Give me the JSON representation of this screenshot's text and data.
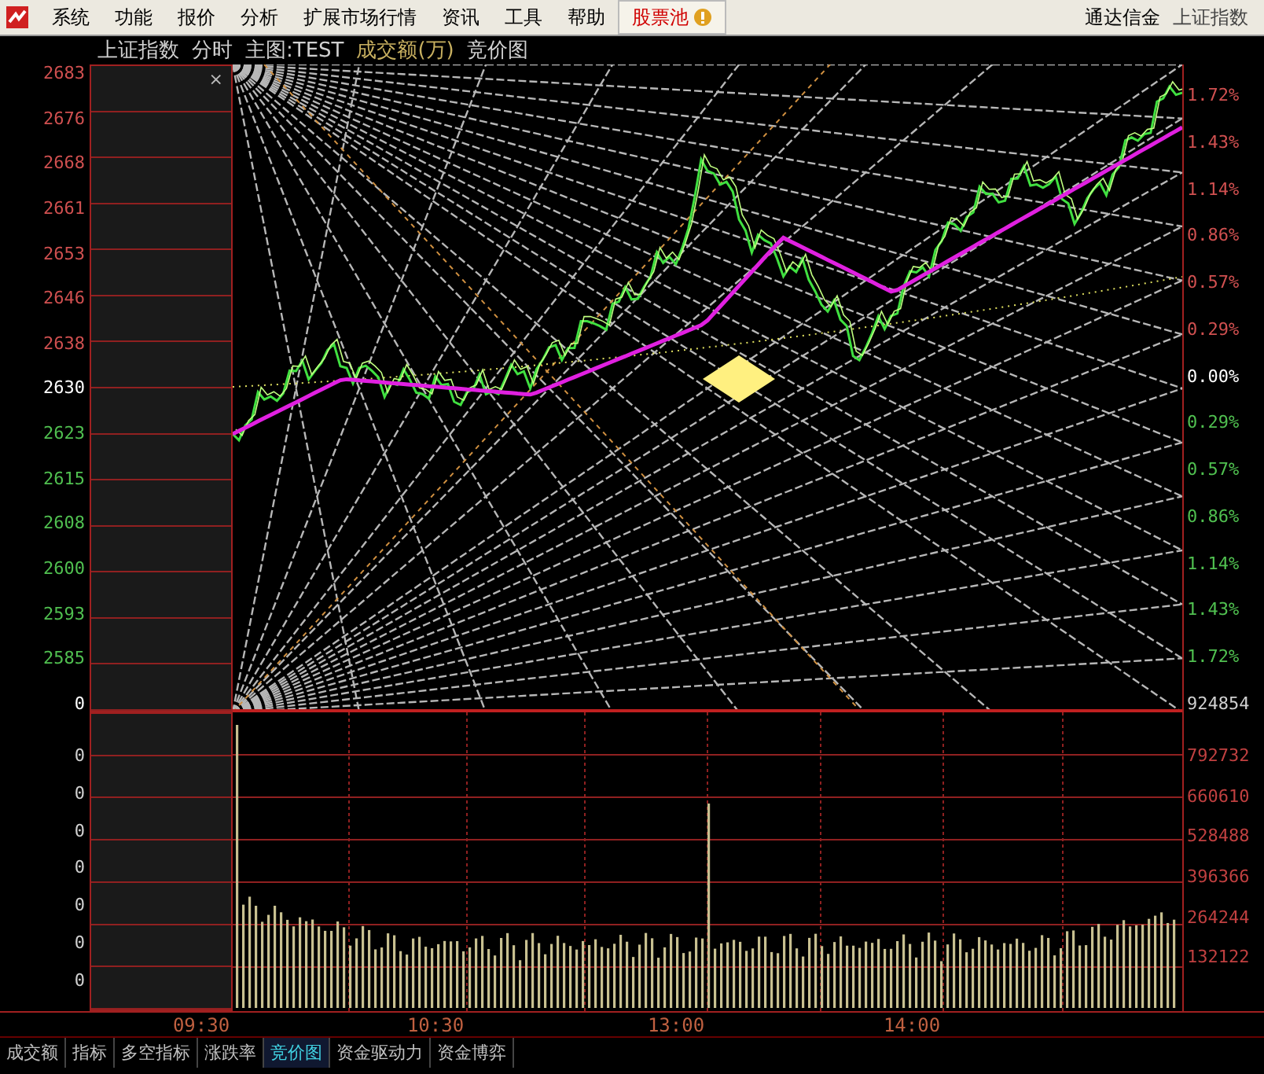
{
  "menu": [
    {
      "label": "系统",
      "kind": "plain"
    },
    {
      "label": "功能",
      "kind": "plain"
    },
    {
      "label": "报价",
      "kind": "plain"
    },
    {
      "label": "分析",
      "kind": "plain"
    },
    {
      "label": "扩展市场行情",
      "kind": "plain"
    },
    {
      "label": "资讯",
      "kind": "plain"
    },
    {
      "label": "工具",
      "kind": "plain"
    },
    {
      "label": "帮助",
      "kind": "plain"
    },
    {
      "label": "股票池",
      "kind": "alert"
    }
  ],
  "menu_right": [
    "通达信金",
    "上证指数"
  ],
  "title": [
    {
      "text": "上证指数",
      "kind": "plain"
    },
    {
      "text": "分时",
      "kind": "plain"
    },
    {
      "text": "主图:TEST",
      "kind": "plain"
    },
    {
      "text": "成交额(万)",
      "kind": "accent"
    },
    {
      "text": "竞价图",
      "kind": "plain"
    }
  ],
  "auction_close": "×",
  "price_axis": [
    {
      "text": "2683",
      "kind": "up"
    },
    {
      "text": "2676",
      "kind": "up"
    },
    {
      "text": "2668",
      "kind": "up"
    },
    {
      "text": "2661",
      "kind": "up"
    },
    {
      "text": "2653",
      "kind": "up"
    },
    {
      "text": "2646",
      "kind": "up"
    },
    {
      "text": "2638",
      "kind": "up"
    },
    {
      "text": "2630",
      "kind": "flat"
    },
    {
      "text": "2623",
      "kind": "down"
    },
    {
      "text": "2615",
      "kind": "down"
    },
    {
      "text": "2608",
      "kind": "down"
    },
    {
      "text": "2600",
      "kind": "down"
    },
    {
      "text": "2593",
      "kind": "down"
    },
    {
      "text": "2585",
      "kind": "down"
    },
    {
      "text": "0",
      "kind": "flat"
    }
  ],
  "percent_axis": [
    {
      "text": "1.72%",
      "kind": "up"
    },
    {
      "text": "1.43%",
      "kind": "up"
    },
    {
      "text": "1.14%",
      "kind": "up"
    },
    {
      "text": "0.86%",
      "kind": "up"
    },
    {
      "text": "0.57%",
      "kind": "up"
    },
    {
      "text": "0.29%",
      "kind": "up"
    },
    {
      "text": "0.00%",
      "kind": "flat"
    },
    {
      "text": "0.29%",
      "kind": "down"
    },
    {
      "text": "0.57%",
      "kind": "down"
    },
    {
      "text": "0.86%",
      "kind": "down"
    },
    {
      "text": "1.14%",
      "kind": "down"
    },
    {
      "text": "1.43%",
      "kind": "down"
    },
    {
      "text": "1.72%",
      "kind": "down"
    }
  ],
  "volume_left_axis": [
    "0",
    "0",
    "0",
    "0",
    "0",
    "0",
    "0"
  ],
  "volume_right_axis": [
    "924854",
    "792732",
    "660610",
    "528488",
    "396366",
    "264244",
    "132122"
  ],
  "time_axis": [
    "09:30",
    "10:30",
    "13:00",
    "14:00"
  ],
  "bottom_tabs": [
    {
      "label": "成交额",
      "selected": false
    },
    {
      "label": "指标",
      "selected": false
    },
    {
      "label": "多空指标",
      "selected": false
    },
    {
      "label": "涨跌率",
      "selected": false
    },
    {
      "label": "竞价图",
      "selected": true
    },
    {
      "label": "资金驱动力",
      "selected": false
    },
    {
      "label": "资金博弈",
      "selected": false
    }
  ]
}
